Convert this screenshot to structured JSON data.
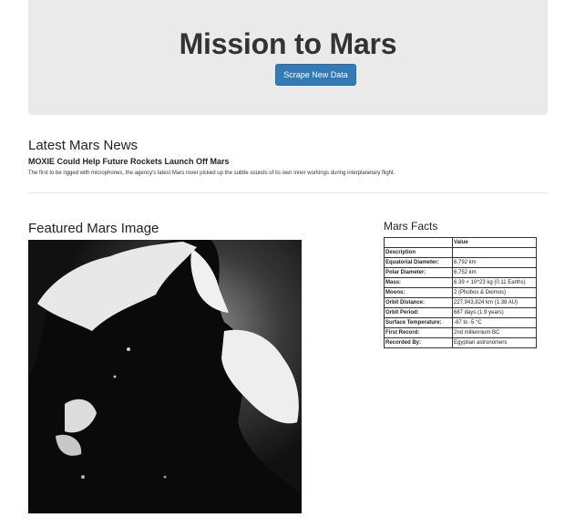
{
  "jumbotron": {
    "title": "Mission to Mars",
    "button_label": "Scrape New Data"
  },
  "news": {
    "heading": "Latest Mars News",
    "title": "MOXIE Could Help Future Rockets Launch Off Mars",
    "teaser": "The first to be rigged with microphones, the agency's latest Mars rover picked up the subtle sounds of its own inner workings during interplanetary flight."
  },
  "featured_image": {
    "heading": "Featured Mars Image"
  },
  "facts": {
    "heading": "Mars Facts",
    "columns": [
      "",
      "Value"
    ],
    "index_label": "Description",
    "rows": [
      {
        "label": "Equatorial Diameter:",
        "value": "6,792 km"
      },
      {
        "label": "Polar Diameter:",
        "value": "6,752 km"
      },
      {
        "label": "Mass:",
        "value": "6.39 × 10^23 kg (0.11 Earths)"
      },
      {
        "label": "Moons:",
        "value": "2 (Phobos & Deimos)"
      },
      {
        "label": "Orbit Distance:",
        "value": "227,943,824 km (1.38 AU)"
      },
      {
        "label": "Orbit Period:",
        "value": "687 days (1.9 years)"
      },
      {
        "label": "Surface Temperature:",
        "value": "-87 to -5 °C"
      },
      {
        "label": "First Record:",
        "value": "2nd millennium BC"
      },
      {
        "label": "Recorded By:",
        "value": "Egyptian astronomers"
      }
    ]
  }
}
